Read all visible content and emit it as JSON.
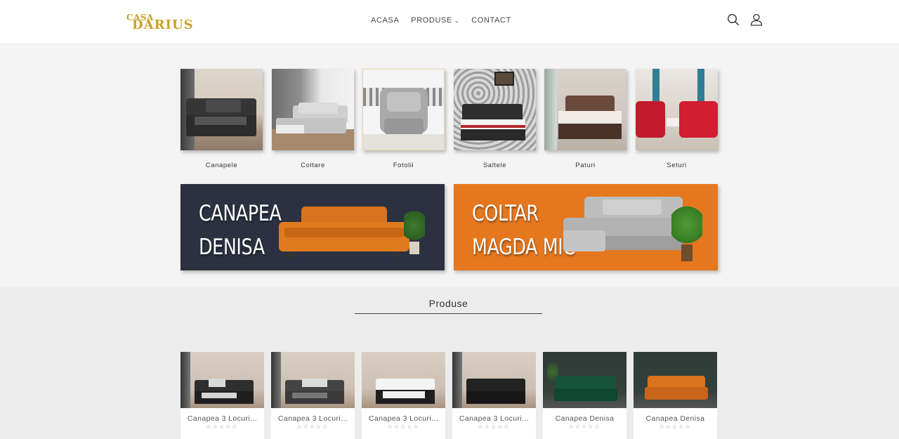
{
  "header": {
    "logo_top": "CASA",
    "logo_bottom": "DARIUS",
    "nav": {
      "home": "ACASA",
      "products": "PRODUSE",
      "contact": "CONTACT"
    },
    "icons": [
      "search-icon",
      "user-icon"
    ]
  },
  "categories": [
    {
      "label": "Canapele"
    },
    {
      "label": "Coltare"
    },
    {
      "label": "Fotolii"
    },
    {
      "label": "Saltele"
    },
    {
      "label": "Paturi"
    },
    {
      "label": "Seturi"
    }
  ],
  "banners": [
    {
      "line1": "CANAPEA",
      "line2": "DENISA"
    },
    {
      "line1": "COLTAR",
      "line2": "MAGDA MIC"
    }
  ],
  "products_section": {
    "title": "Produse",
    "items": [
      {
        "name": "Canapea 3 Locuri...",
        "rating": "☆☆☆☆☆"
      },
      {
        "name": "Canapea 3 Locuri...",
        "rating": "☆☆☆☆☆"
      },
      {
        "name": "Canapea 3 Locuri...",
        "rating": "☆☆☆☆☆"
      },
      {
        "name": "Canapea 3 Locuri...",
        "rating": "☆☆☆☆☆"
      },
      {
        "name": "Canapea Denisa",
        "rating": "☆☆☆☆☆"
      },
      {
        "name": "Canapea Denisa",
        "rating": "☆☆☆☆☆"
      }
    ]
  },
  "colors": {
    "brand_gold": "#c9a227",
    "banner_navy": "#2b3140",
    "banner_orange": "#e5771e"
  }
}
